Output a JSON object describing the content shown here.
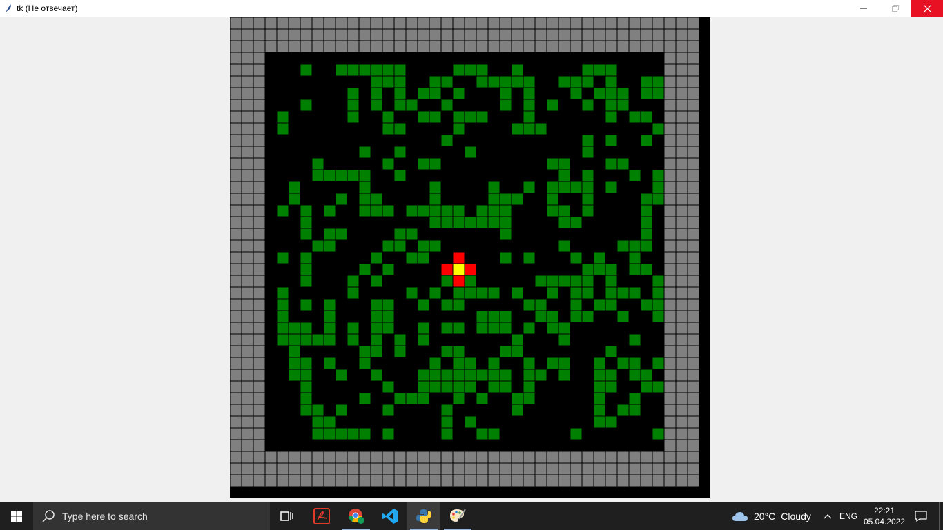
{
  "window": {
    "title": "tk (Не отвечает)",
    "icon": "tk-feather-icon",
    "controls": {
      "minimize_icon": "minimize-icon",
      "maximize_icon": "restore-icon",
      "close_icon": "close-icon"
    }
  },
  "game": {
    "cols": 40,
    "rows": 40,
    "colors": {
      "background": "#000000",
      "wall": "#808080",
      "plant": "#008000",
      "blast": "#ff0000",
      "center": "#ffff00"
    },
    "board": [
      "WWWWWWWWWWWWWWWWWWWWWWWWWWWWWWWWWWWWWWWW",
      "WWWWWWWWWWWWWWWWWWWWWWWWWWWWWWWWWWWWWWWW",
      "WWWWWWWWWWWWWWWWWWWWWWWWWWWWWWWWWWWWWWWW",
      "WWW.................................WWWW",
      "WWW...G..GGGGGG....GGG..G.....GGG....G.WWW",
      "WWW.........GGG..GG..GGGGG..GGG.G..GG..WWW",
      "WWW.......G.G.G.GG.G...G.G...G.GGG.GG..WWW",
      "WWW...G...G.G.GG..G....G.G.G..G.GG.....WWW",
      "WWW.G.....G..G..GG.GGG...G......G.GG.GG.WWW",
      "WWW.G........GG....G....GGG.........G....WWW",
      "WWW...............G...........G.G..G..G.WWW",
      "WWW........G..G.....G.........G......G..WWW",
      "WWW....G.....G..GG.........GG...GG...GGWWW",
      "WWW....GGGGG..G.............G.G...G.G.GGWWW",
      "WWW..G.....G.....G....G..G.GGGG.G...G.GGGWWW",
      "WWW..G...G.GG....G....GGG..G..G....GGGGWWW",
      "WWW.G.G.G..GGG.GGGGG.GGG...GG.G....G..GWWW",
      "WWW...G..........GGGGGGG....GG.....G.GG.GWWW",
      "WWW...G.GG....GG.......G...........G......WWW",
      "WWW....GG....GG.GG..........G....GGG.G....WWW",
      "WWW.G.G.....G..GG..G...G.G...G.G..G.......WWW",
      "WWW...G....G.G................GGG.GG......WWW",
      "WWW...G...G.G.....G.G.....GGGGG.G...G.G...WWW",
      "WWW.G.....G....G.G.GGGG.G..G.GG.GGG.GG....WWW",
      "WWW.G.G.G...GG..G.GG.....GG..G.GG..GG...G.WWW",
      "WWW.G...G...GG.......GGG..GG.GG..G..GG.G..WWW",
      "WWW.GGG.G.G.GG..G.GG.GGG.G.GG............WWW",
      "WWW.GGGGG.G.G.G.G.......G...G.....G.......G.WWW",
      "WWW..G.....GG.G...GG...GG.......G.........WWW",
      "WWW..GG.G..G.....G.GG.G..G.GG..G.GG.G..G.WWW",
      "WWW..GG..G..G...GGGGGGGG.GG.G..GG.GG......WWW",
      "WWW...G......G..GGGGG.GG.G.....GG..GG.GG..WWW",
      "WWW...G....G..GGG..G.G..GG.....G..G..G....WWW",
      "WWW...GG.G...G....G.....G......G.GG...GG..WWW",
      "WWW....GG.........G.G..........GG.........WWW",
      "WWW....GGGGG.G....G..GG......G......GGGG..WWW",
      "WWW.....................................WWWW",
      "WWWWWWWWWWWWWWWWWWWWWWWWWWWWWWWWWWWWWWWW",
      "WWWWWWWWWWWWWWWWWWWWWWWWWWWWWWWWWWWWWWWW",
      "WWWWWWWWWWWWWWWWWWWWWWWWWWWWWWWWWWWWWWWW"
    ],
    "blast_cells": [
      [
        20,
        19
      ],
      [
        21,
        18
      ],
      [
        21,
        20
      ],
      [
        22,
        19
      ]
    ],
    "center_cell": [
      21,
      19
    ]
  },
  "taskbar": {
    "start_icon": "windows-start-icon",
    "search_placeholder": "Type here to search",
    "search_icon": "search-icon",
    "apps": [
      {
        "name": "task-view-icon"
      },
      {
        "name": "acrobat-icon"
      },
      {
        "name": "chrome-icon"
      },
      {
        "name": "vscode-icon"
      },
      {
        "name": "python-icon"
      },
      {
        "name": "paint-icon"
      }
    ],
    "weather": {
      "temp": "20°C",
      "condition": "Cloudy",
      "icon": "cloud-icon"
    },
    "language": "ENG",
    "time": "22:21",
    "date": "05.04.2022",
    "notification_icon": "notification-icon"
  }
}
